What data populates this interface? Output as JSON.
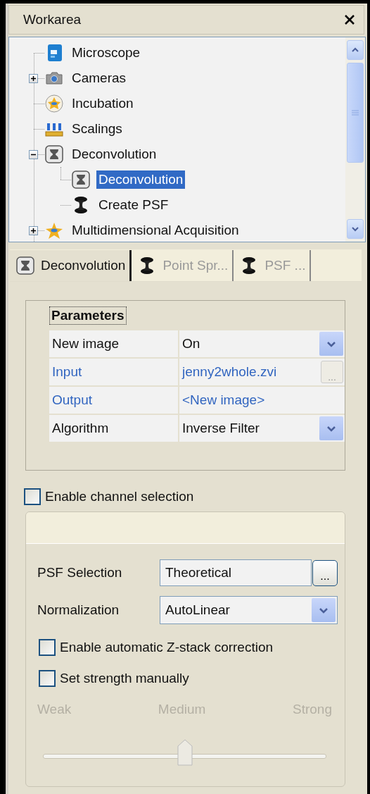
{
  "panel": {
    "title": "Workarea"
  },
  "tree": {
    "items": [
      {
        "label": "Microscope",
        "kind": "device",
        "selected": false
      },
      {
        "label": "Cameras",
        "kind": "camera",
        "expanded": false,
        "selected": false
      },
      {
        "label": "Incubation",
        "kind": "badge",
        "selected": false
      },
      {
        "label": "Scalings",
        "kind": "ruler",
        "selected": false
      },
      {
        "label": "Deconvolution",
        "kind": "hourglass",
        "expanded": true,
        "selected": false,
        "children": [
          {
            "label": "Deconvolution",
            "kind": "hourglass",
            "selected": true
          },
          {
            "label": "Create PSF",
            "kind": "spool",
            "selected": false
          }
        ]
      },
      {
        "label": "Multidimensional Acquisition",
        "kind": "star",
        "expanded": false,
        "selected": false
      }
    ]
  },
  "tabs": [
    {
      "label": "Deconvolution",
      "kind": "hourglass",
      "selected": true
    },
    {
      "label": "Point Spr...",
      "kind": "spool",
      "selected": false
    },
    {
      "label": "PSF ...",
      "kind": "spool",
      "selected": false
    }
  ],
  "properties": {
    "section": "Parameters",
    "rows": [
      {
        "name": "New image",
        "value": "On",
        "link": false,
        "kind": "dropdown"
      },
      {
        "name": "Input",
        "value": "jenny2whole.zvi",
        "link": true,
        "kind": "browse",
        "button": "..."
      },
      {
        "name": "Output",
        "value": "<New image>",
        "link": true,
        "kind": "plain"
      },
      {
        "name": "Algorithm",
        "value": "Inverse Filter",
        "link": false,
        "kind": "dropdown"
      }
    ]
  },
  "channel_selection": {
    "label": "Enable channel selection",
    "checked": false
  },
  "settings": {
    "psf_selection": {
      "label": "PSF Selection",
      "value": "Theoretical",
      "button": "..."
    },
    "normalization": {
      "label": "Normalization",
      "value": "AutoLinear"
    },
    "options": [
      {
        "label": "Enable automatic Z-stack correction",
        "checked": false
      },
      {
        "label": "Set strength manually",
        "checked": false
      }
    ],
    "strength": {
      "disabled": true,
      "labels": [
        "Weak",
        "Medium",
        "Strong"
      ],
      "level": 0.5
    }
  }
}
